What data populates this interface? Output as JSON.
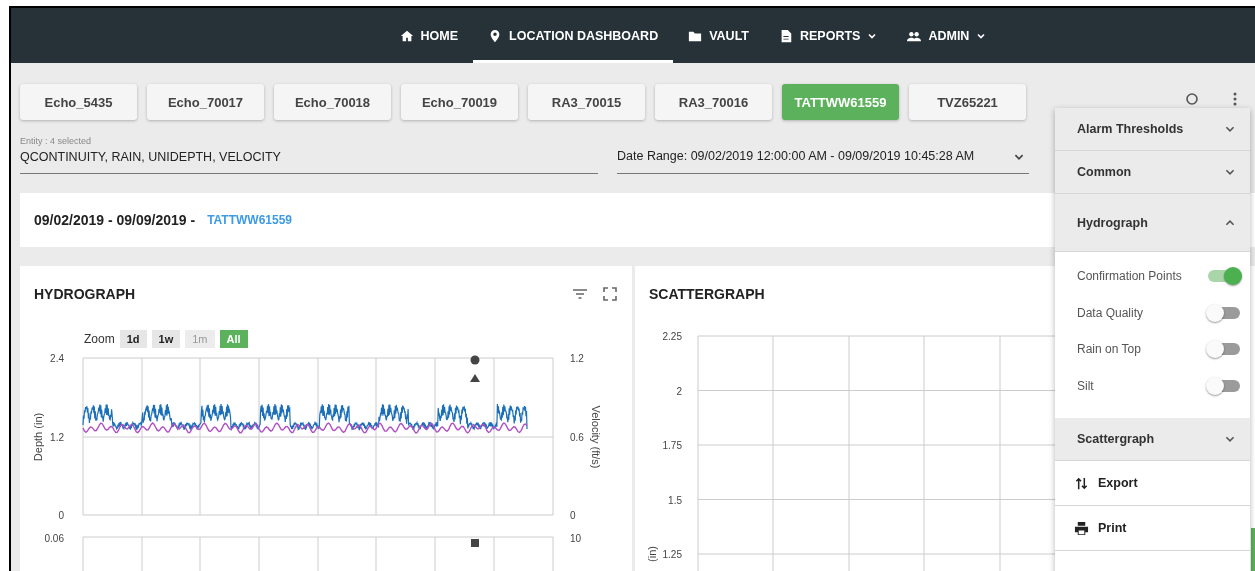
{
  "nav": [
    {
      "label": "HOME",
      "selected": false,
      "dropdown": false
    },
    {
      "label": "LOCATION DASHBOARD",
      "selected": true,
      "dropdown": false
    },
    {
      "label": "VAULT",
      "selected": false,
      "dropdown": false
    },
    {
      "label": "REPORTS",
      "selected": false,
      "dropdown": true
    },
    {
      "label": "ADMIN",
      "selected": false,
      "dropdown": true
    }
  ],
  "locations": [
    {
      "label": "Echo_5435",
      "selected": false
    },
    {
      "label": "Echo_70017",
      "selected": false
    },
    {
      "label": "Echo_70018",
      "selected": false
    },
    {
      "label": "Echo_70019",
      "selected": false
    },
    {
      "label": "RA3_70015",
      "selected": false
    },
    {
      "label": "RA3_70016",
      "selected": false
    },
    {
      "label": "TATTWW61559",
      "selected": true
    },
    {
      "label": "TVZ65221",
      "selected": false
    }
  ],
  "entity": {
    "label": "Entity : 4 selected",
    "value": "QCONTINUITY, RAIN, UNIDEPTH, VELOCITY"
  },
  "date_range": {
    "value": "Date Range: 09/02/2019 12:00:00 AM - 09/09/2019 10:45:28 AM"
  },
  "header": {
    "dates": "09/02/2019 - 09/09/2019 -",
    "location": "TATTWW61559"
  },
  "hydrograph": {
    "title": "HYDROGRAPH",
    "zoom_label": "Zoom",
    "zoom": [
      {
        "label": "1d",
        "selected": false,
        "disabled": false
      },
      {
        "label": "1w",
        "selected": false,
        "disabled": false
      },
      {
        "label": "1m",
        "selected": false,
        "disabled": true
      },
      {
        "label": "All",
        "selected": true,
        "disabled": false
      }
    ],
    "left_ticks": [
      "2.4",
      "1.2",
      "0"
    ],
    "right_ticks": [
      "1.2",
      "0.6",
      "0"
    ],
    "left_title": "Depth (in)",
    "right_title": "Velocity (ft/s)",
    "lower_left_tick": "0.06",
    "lower_right_tick": "10"
  },
  "scattergraph": {
    "title": "SCATTERGRAPH",
    "y_ticks": [
      "2.25",
      "2",
      "1.75",
      "1.5",
      "1.25"
    ],
    "y_title": "(in)"
  },
  "panel": {
    "sections": [
      {
        "title": "Alarm Thresholds",
        "expanded": false
      },
      {
        "title": "Common",
        "expanded": false
      },
      {
        "title": "Hydrograph",
        "expanded": true,
        "options": [
          {
            "label": "Confirmation Points",
            "on": true
          },
          {
            "label": "Data Quality",
            "on": false
          },
          {
            "label": "Rain on Top",
            "on": false
          },
          {
            "label": "Silt",
            "on": false
          }
        ]
      },
      {
        "title": "Scattergraph",
        "expanded": false
      }
    ],
    "actions": [
      {
        "label": "Export"
      },
      {
        "label": "Print"
      }
    ]
  }
}
